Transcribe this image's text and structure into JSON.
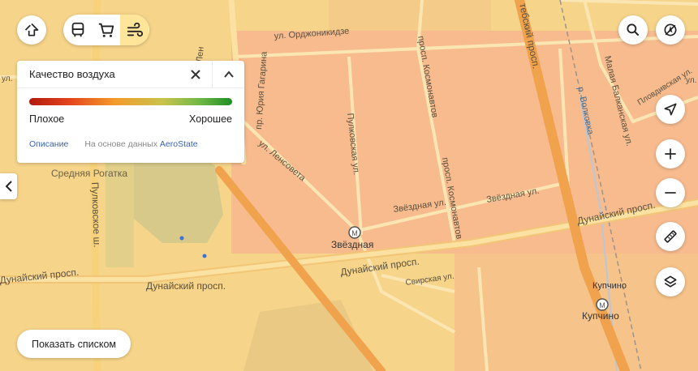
{
  "map": {
    "streets": {
      "ordzhonikidze": "ул. Орджоникидзе",
      "yuria_gagarina": "пр. Юрия Гагарина",
      "lensoveta_top": "ул. Лен",
      "lensoveta": "ул. Ленсовета",
      "pulkovskaya": "Пулковская ул.",
      "kosmonavtov_top": "просп. Космонавтов",
      "kosmonavtov": "просп. Космонавтов",
      "vitebsky": "тебский просп.",
      "malaya_balkanskaya": "Малая Балканская ул.",
      "volkovka": "р. Волковка",
      "plovdivskaya": "Пловдивская ул.",
      "zvezdnaya_1": "Звёздная ул.",
      "zvezdnaya_2": "Звёздная ул.",
      "dunaysky_east": "Дунайский просп.",
      "dunaysky_mid": "Дунайский просп.",
      "dunaysky_west": "Дунайский просп.",
      "dunaysky_far": "Дунайский просп.",
      "pulkovskoe": "Пулковское ш.",
      "svirskaya": "Свирская ул.",
      "left_edge": "ул.",
      "right_edge": "ул."
    },
    "places": {
      "srednyaya_rogatka": "Средняя Рогатка",
      "zvezdnaya": "Звёздная",
      "kupchino_station": "Купчино",
      "kupchino_metro": "Купчино"
    },
    "overlay_color": "#f7b38f"
  },
  "controls": {
    "routes_icon": "routes-icon",
    "transport_icon": "bus-icon",
    "shopping_icon": "cart-icon",
    "air_icon": "wind-icon",
    "search_icon": "search-icon",
    "traffic_icon": "no-traffic-icon",
    "location_icon": "navigation-arrow-icon",
    "zoom_in_icon": "plus-icon",
    "zoom_out_icon": "minus-icon",
    "ruler_icon": "ruler-icon",
    "layers_icon": "layers-icon"
  },
  "air_panel": {
    "title": "Качество воздуха",
    "bad_label": "Плохое",
    "good_label": "Хорошее",
    "description_link": "Описание",
    "source_prefix": "На основе данных",
    "source_name": "AeroState"
  },
  "list_button": "Показать списком"
}
